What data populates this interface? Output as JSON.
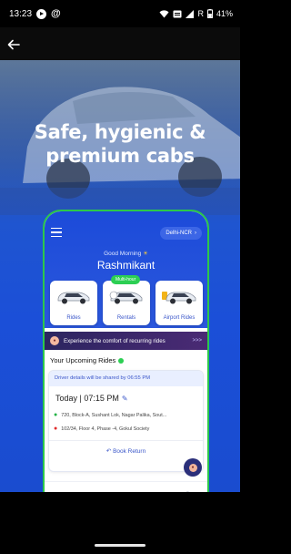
{
  "status_bar": {
    "time": "13:23",
    "battery": "41%",
    "network": "R"
  },
  "header": {
    "back_icon": "arrow-left-icon"
  },
  "hero": {
    "title_line1": "Safe, hygienic &",
    "title_line2": "premium cabs"
  },
  "app": {
    "city": "Delhi-NCR",
    "greeting": "Good Morning",
    "user_name": "Rashmikant",
    "services": [
      {
        "label": "Rides"
      },
      {
        "label": "Rentals",
        "badge": "Multi-hour"
      },
      {
        "label": "Airport Rides"
      }
    ],
    "banner": {
      "text": "Experience the comfort of recurring rides",
      "arrow": ">>>"
    },
    "upcoming": {
      "title": "Your Upcoming Rides",
      "driver_note": "Driver details will be shared by 06:55 PM",
      "time": "Today | 07:15 PM",
      "from": "720, Block-A, Sushant Lok, Nagar Palika, Sout...",
      "to": "102/34, Floor 4, Phase -4, Gokul Society",
      "book_return": "Book Return"
    }
  },
  "colors": {
    "brand_blue": "#1c4bd9",
    "accent_green": "#2cc84a",
    "banner_purple": "#2c2560"
  }
}
